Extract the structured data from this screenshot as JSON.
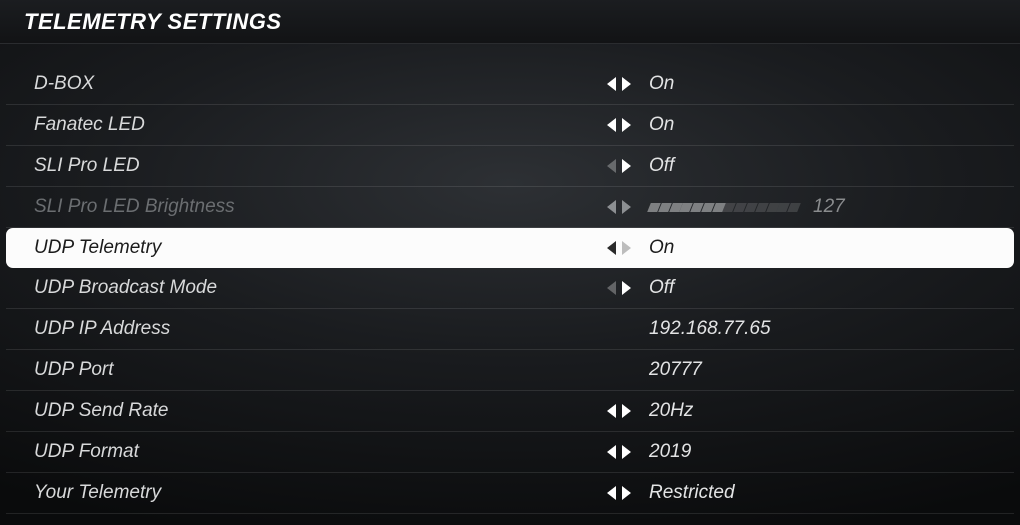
{
  "title": "TELEMETRY SETTINGS",
  "rows": [
    {
      "id": "d-box",
      "label": "D-BOX",
      "type": "toggle",
      "value": "On",
      "left_active": true,
      "right_active": true,
      "disabled": false,
      "selected": false
    },
    {
      "id": "fanatec-led",
      "label": "Fanatec LED",
      "type": "toggle",
      "value": "On",
      "left_active": true,
      "right_active": true,
      "disabled": false,
      "selected": false
    },
    {
      "id": "sli-pro-led",
      "label": "SLI Pro LED",
      "type": "toggle",
      "value": "Off",
      "left_active": false,
      "right_active": true,
      "disabled": false,
      "selected": false
    },
    {
      "id": "sli-pro-bright",
      "label": "SLI Pro LED Brightness",
      "type": "slider",
      "value": "127",
      "slider_min": 0,
      "slider_max": 255,
      "slider_value": 127,
      "left_active": true,
      "right_active": true,
      "disabled": true,
      "selected": false
    },
    {
      "id": "udp-telemetry",
      "label": "UDP Telemetry",
      "type": "toggle",
      "value": "On",
      "left_active": true,
      "right_active": false,
      "disabled": false,
      "selected": true
    },
    {
      "id": "udp-broadcast",
      "label": "UDP Broadcast Mode",
      "type": "toggle",
      "value": "Off",
      "left_active": false,
      "right_active": true,
      "disabled": false,
      "selected": false
    },
    {
      "id": "udp-ip",
      "label": "UDP IP Address",
      "type": "text",
      "value": "192.168.77.65",
      "left_active": false,
      "right_active": false,
      "disabled": false,
      "selected": false
    },
    {
      "id": "udp-port",
      "label": "UDP Port",
      "type": "text",
      "value": "20777",
      "left_active": false,
      "right_active": false,
      "disabled": false,
      "selected": false
    },
    {
      "id": "udp-send-rate",
      "label": "UDP Send Rate",
      "type": "toggle",
      "value": "20Hz",
      "left_active": true,
      "right_active": true,
      "disabled": false,
      "selected": false
    },
    {
      "id": "udp-format",
      "label": "UDP Format",
      "type": "toggle",
      "value": "2019",
      "left_active": true,
      "right_active": true,
      "disabled": false,
      "selected": false
    },
    {
      "id": "your-telemetry",
      "label": "Your Telemetry",
      "type": "toggle",
      "value": "Restricted",
      "left_active": true,
      "right_active": true,
      "disabled": false,
      "selected": false
    }
  ]
}
